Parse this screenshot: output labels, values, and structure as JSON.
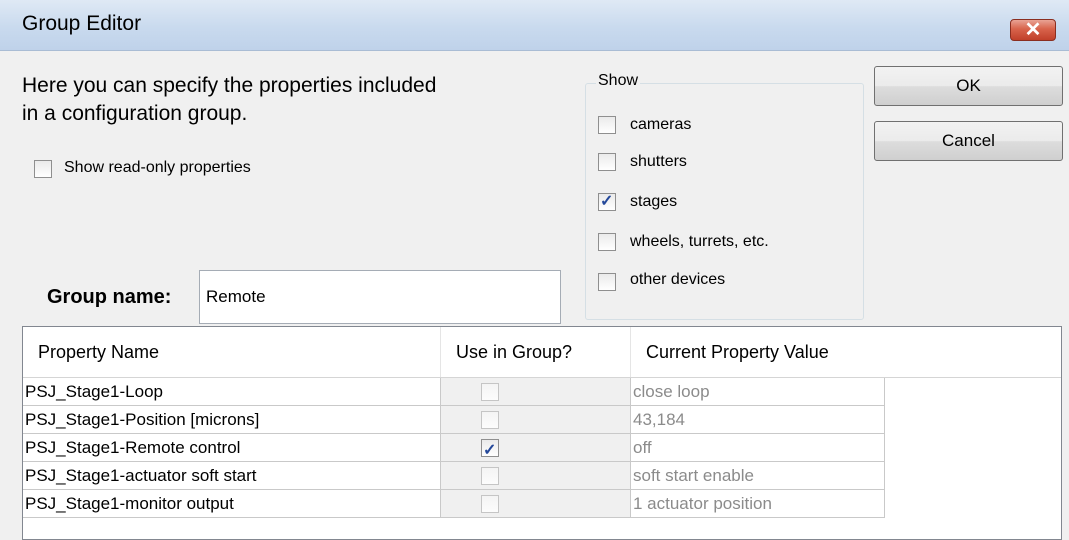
{
  "window": {
    "title": "Group Editor"
  },
  "intro": {
    "line1": "Here you can specify the properties included",
    "line2": "in a configuration group."
  },
  "readonly_option": {
    "label": "Show read-only properties",
    "checked": false
  },
  "show_group": {
    "legend": "Show",
    "options": [
      {
        "label": "cameras",
        "checked": false
      },
      {
        "label": "shutters",
        "checked": false
      },
      {
        "label": "stages",
        "checked": true
      },
      {
        "label": "wheels, turrets, etc.",
        "checked": false
      },
      {
        "label": "other devices",
        "checked": false
      }
    ]
  },
  "buttons": {
    "ok": "OK",
    "cancel": "Cancel"
  },
  "group_name": {
    "label": "Group name:",
    "value": "Remote"
  },
  "table": {
    "columns": [
      "Property Name",
      "Use in Group?",
      "Current Property Value"
    ],
    "rows": [
      {
        "name": "PSJ_Stage1-Loop",
        "use": false,
        "value": "close loop"
      },
      {
        "name": "PSJ_Stage1-Position [microns]",
        "use": false,
        "value": "43,184"
      },
      {
        "name": "PSJ_Stage1-Remote control",
        "use": true,
        "value": "off"
      },
      {
        "name": "PSJ_Stage1-actuator soft start",
        "use": false,
        "value": "soft start enable"
      },
      {
        "name": "PSJ_Stage1-monitor output",
        "use": false,
        "value": "1 actuator position"
      }
    ]
  },
  "check_glyph": "✓",
  "close_glyph": "✕"
}
